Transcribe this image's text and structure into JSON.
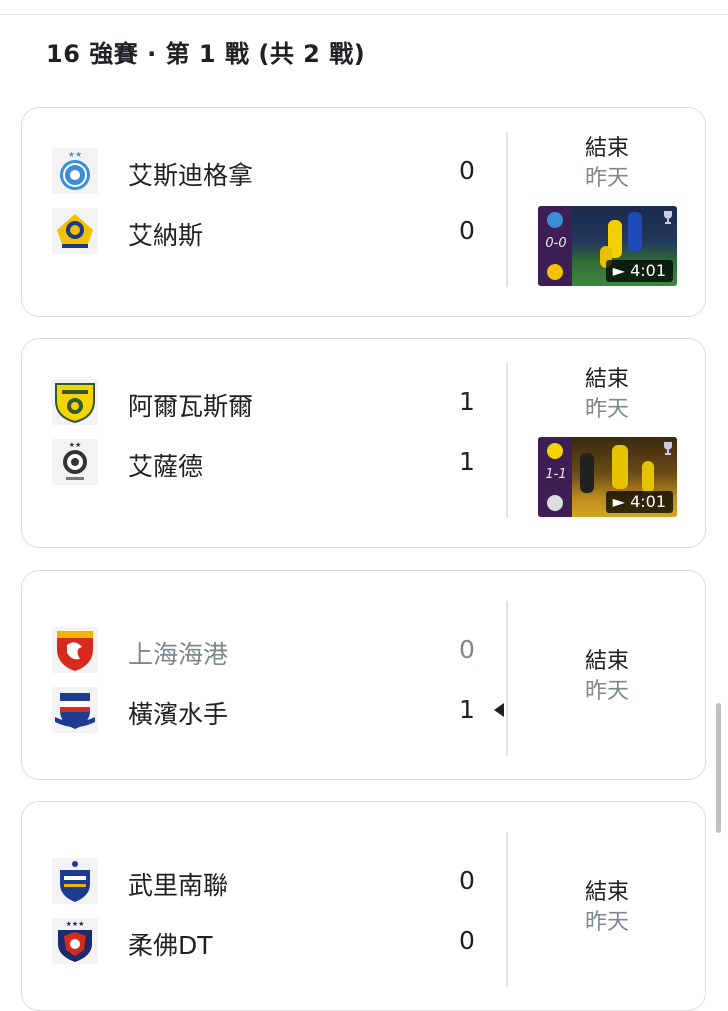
{
  "section": {
    "title": "16 強賽 · 第 1 戰 (共 2 戰)"
  },
  "matches": [
    {
      "home": {
        "name": "艾斯迪格拿",
        "score": "0",
        "logo_icon": "esteghlal-logo-icon"
      },
      "away": {
        "name": "艾納斯",
        "score": "0",
        "logo_icon": "al-nassr-logo-icon"
      },
      "status": "結束",
      "date": "昨天",
      "highlight": {
        "score_text": "0-0",
        "duration": "4:01"
      }
    },
    {
      "home": {
        "name": "阿爾瓦斯爾",
        "score": "1",
        "logo_icon": "al-wasl-logo-icon"
      },
      "away": {
        "name": "艾薩德",
        "score": "1",
        "logo_icon": "al-sadd-logo-icon"
      },
      "status": "結束",
      "date": "昨天",
      "highlight": {
        "score_text": "1-1",
        "duration": "4:01"
      }
    },
    {
      "home": {
        "name": "上海海港",
        "score": "0",
        "logo_icon": "shanghai-port-logo-icon"
      },
      "away": {
        "name": "橫濱水手",
        "score": "1",
        "logo_icon": "yokohama-marinos-logo-icon"
      },
      "status": "結束",
      "date": "昨天"
    },
    {
      "home": {
        "name": "武里南聯",
        "score": "0",
        "logo_icon": "buriram-united-logo-icon"
      },
      "away": {
        "name": "柔佛DT",
        "score": "0",
        "logo_icon": "johor-dt-logo-icon"
      },
      "status": "結束",
      "date": "昨天"
    }
  ],
  "colors": {
    "divider": "#e3e3e3",
    "loser_text": "#80868b",
    "card_border": "#dadce0"
  }
}
